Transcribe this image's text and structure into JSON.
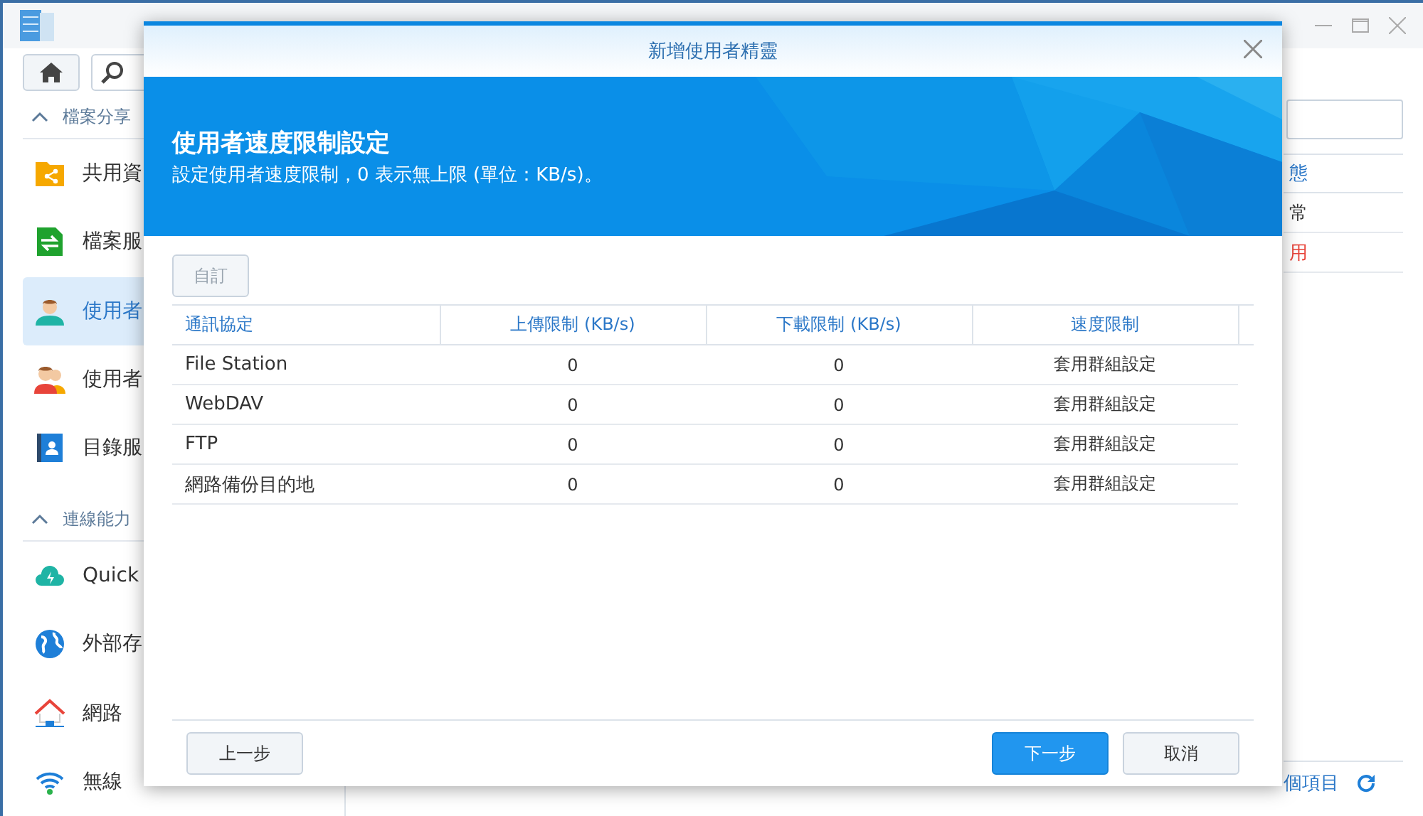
{
  "sidebar": {
    "sections": [
      {
        "title": "檔案分享",
        "expanded": true,
        "items": [
          {
            "label": "共用資",
            "selected": false
          },
          {
            "label": "檔案服",
            "selected": false
          },
          {
            "label": "使用者",
            "selected": true
          },
          {
            "label": "使用者",
            "selected": false
          },
          {
            "label": "目錄服",
            "selected": false
          }
        ]
      },
      {
        "title": "連線能力",
        "expanded": true,
        "items": [
          {
            "label": "Quick",
            "selected": false
          },
          {
            "label": "外部存",
            "selected": false
          },
          {
            "label": "網路",
            "selected": false
          },
          {
            "label": "無線",
            "selected": false
          }
        ]
      }
    ]
  },
  "background_table": {
    "header": "態",
    "rows": [
      {
        "text": "常",
        "kind": "normal"
      },
      {
        "text": "用",
        "kind": "disabled"
      }
    ],
    "footer": "個項目"
  },
  "dialog": {
    "title": "新增使用者精靈",
    "heading": "使用者速度限制設定",
    "subtitle": "設定使用者速度限制，0 表示無上限 (單位：KB/s)。",
    "custom_button": {
      "label": "自訂",
      "disabled": true
    },
    "columns": [
      "通訊協定",
      "上傳限制 (KB/s)",
      "下載限制 (KB/s)",
      "速度限制"
    ],
    "rows": [
      [
        "File Station",
        "0",
        "0",
        "套用群組設定"
      ],
      [
        "WebDAV",
        "0",
        "0",
        "套用群組設定"
      ],
      [
        "FTP",
        "0",
        "0",
        "套用群組設定"
      ],
      [
        "網路備份目的地",
        "0",
        "0",
        "套用群組設定"
      ]
    ],
    "buttons": [
      {
        "label": "上一步",
        "kind": "secondary"
      },
      {
        "label": "下一步",
        "kind": "primary"
      },
      {
        "label": "取消",
        "kind": "secondary"
      }
    ]
  }
}
